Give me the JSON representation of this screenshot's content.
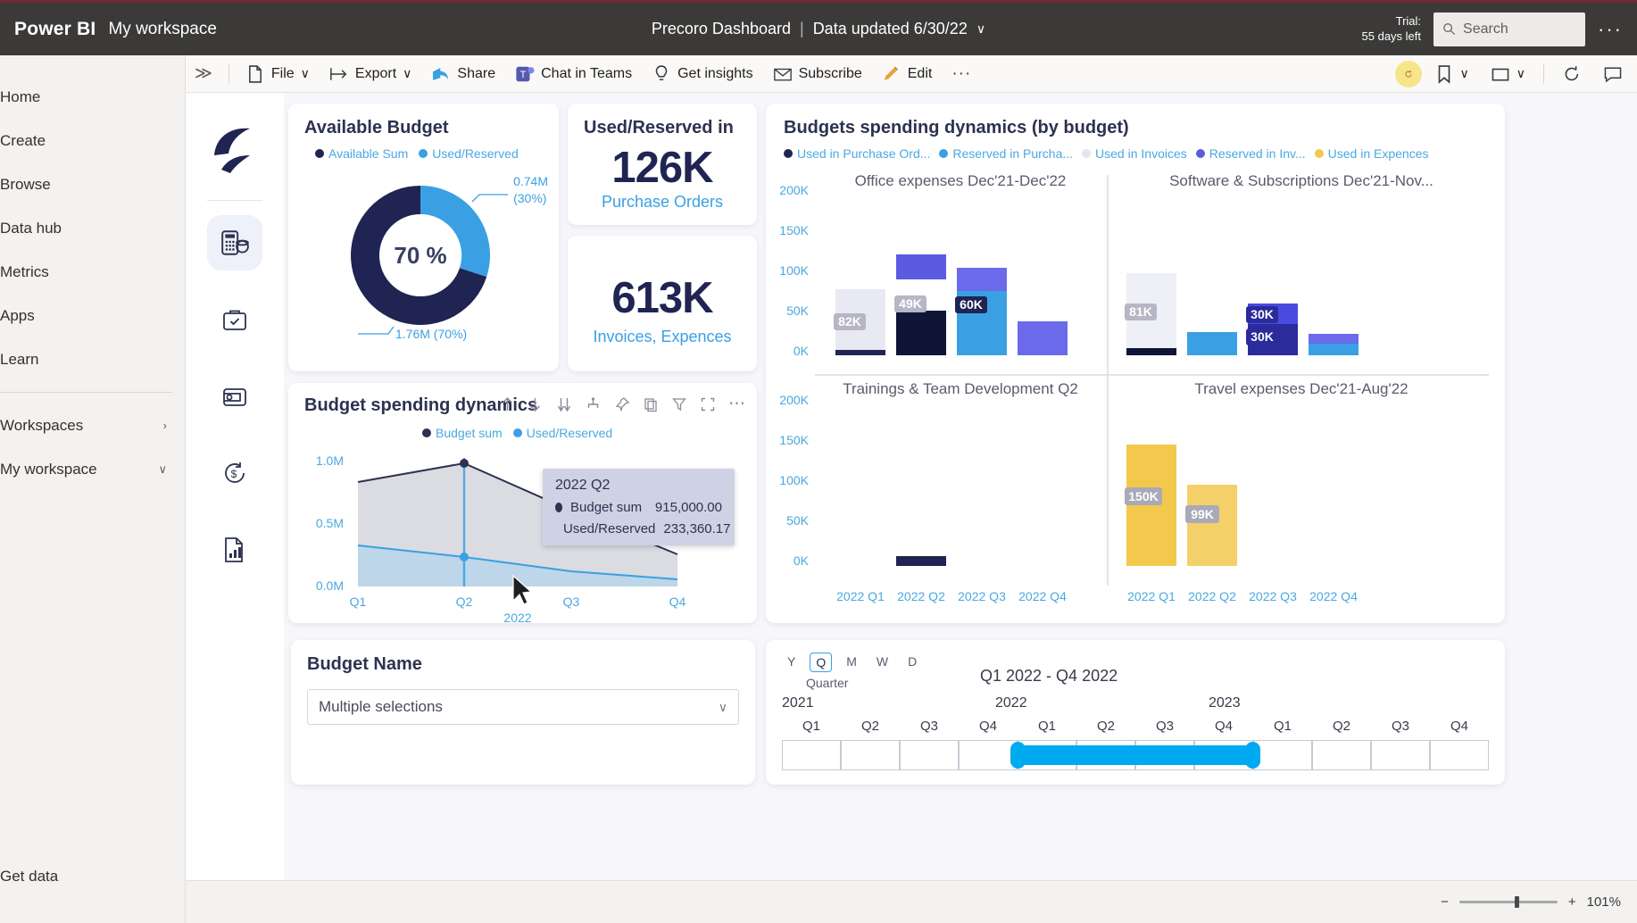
{
  "topbar": {
    "brand": "Power BI",
    "workspace": "My workspace",
    "report_title": "Precoro Dashboard",
    "separator": "|",
    "data_updated": "Data updated 6/30/22",
    "chevron": "∨",
    "trial_line1": "Trial:",
    "trial_line2": "55 days left",
    "search_placeholder": "Search",
    "more": "···"
  },
  "leftnav": {
    "items": [
      {
        "label": "Home"
      },
      {
        "label": "Create"
      },
      {
        "label": "Browse"
      },
      {
        "label": "Data hub"
      },
      {
        "label": "Metrics"
      },
      {
        "label": "Apps"
      },
      {
        "label": "Learn"
      }
    ],
    "groups": [
      {
        "label": "Workspaces",
        "arrow": "›"
      },
      {
        "label": "My workspace",
        "arrow": "∨"
      }
    ],
    "get_data": "Get data"
  },
  "ribbon": {
    "expand": "≫",
    "items": [
      {
        "label": "File",
        "icon": "file-icon",
        "chevron": "∨"
      },
      {
        "label": "Export",
        "icon": "export-icon",
        "chevron": "∨"
      },
      {
        "label": "Share",
        "icon": "share-icon",
        "chevron": ""
      },
      {
        "label": "Chat in Teams",
        "icon": "teams-icon",
        "chevron": ""
      },
      {
        "label": "Get insights",
        "icon": "bulb-icon",
        "chevron": ""
      },
      {
        "label": "Subscribe",
        "icon": "mail-icon",
        "chevron": ""
      },
      {
        "label": "Edit",
        "icon": "pencil-icon",
        "chevron": ""
      }
    ],
    "more": "···",
    "right_icons": [
      "reset-icon",
      "bookmark-icon",
      "view-icon",
      "refresh-icon",
      "comment-icon"
    ]
  },
  "colors": {
    "navy": "#1f2452",
    "lightblue": "#3aa0e3",
    "accent_text": "#4aa8e0",
    "purple": "#5b5be0",
    "yellow": "#f2c94c",
    "pale": "#e9e9f4",
    "title": "#2d3250"
  },
  "available_budget": {
    "title": "Available Budget",
    "legend": [
      {
        "label": "Available Sum",
        "color": "#1f2452"
      },
      {
        "label": "Used/Reserved",
        "color": "#3aa0e3"
      }
    ],
    "center_label": "70 %",
    "label_top": "0.74M\n(30%)",
    "label_top_l1": "0.74M",
    "label_top_l2": "(30%)",
    "label_bottom": "1.76M (70%)"
  },
  "chart_data": [
    {
      "type": "pie",
      "title": "Available Budget",
      "labels": [
        "Available Sum",
        "Used/Reserved"
      ],
      "values": [
        1.76,
        0.74
      ],
      "value_labels": [
        "1.76M (70%)",
        "0.74M (30%)"
      ],
      "percentages": [
        70,
        30
      ],
      "center_text": "70 %",
      "colors": [
        "#1f2452",
        "#3aa0e3"
      ],
      "legend_position": "top"
    },
    {
      "type": "line",
      "title": "Budget spending dynamics",
      "xlabel": "2022",
      "categories": [
        "Q1",
        "Q2",
        "Q3",
        "Q4"
      ],
      "series": [
        {
          "name": "Budget sum",
          "values": [
            880000,
            915000,
            590000,
            300000
          ],
          "color": "#2d3250"
        },
        {
          "name": "Used/Reserved",
          "values": [
            330000,
            233360,
            160000,
            60000
          ],
          "color": "#3aa0e3"
        }
      ],
      "yticks": [
        "0.0M",
        "0.5M",
        "1.0M"
      ],
      "ylim": [
        0,
        1000000
      ],
      "grid": false,
      "legend_position": "top",
      "tooltip": {
        "header": "2022 Q2",
        "rows": [
          {
            "name": "Budget sum",
            "value": "915,000.00",
            "color": "#2d3250"
          },
          {
            "name": "Used/Reserved",
            "value": "233,360.17",
            "color": "#3aa0e3"
          }
        ]
      }
    },
    {
      "type": "bar",
      "title": "Budgets spending dynamics (by budget)",
      "legend": [
        {
          "label": "Used in Purchase Ord...",
          "color": "#1f2452"
        },
        {
          "label": "Reserved in Purcha...",
          "color": "#3aa0e3"
        },
        {
          "label": "Used in Invoices",
          "color": "#e4e4f2"
        },
        {
          "label": "Reserved in Inv...",
          "color": "#5b5be0"
        },
        {
          "label": "Used in Expences",
          "color": "#f2c94c"
        }
      ],
      "yticks": [
        "0K",
        "50K",
        "100K",
        "150K",
        "200K"
      ],
      "ylim": [
        0,
        200000
      ],
      "panels": [
        {
          "title": "Office expenses Dec'21-Dec'22",
          "categories": [
            "2022 Q1",
            "2022 Q2",
            "2022 Q3",
            "2022 Q4"
          ],
          "bars": [
            {
              "label": "82K",
              "value": 82000,
              "color": "#e9e9f4"
            },
            {
              "label": "49K",
              "value": 49000,
              "color": "#5b5be0"
            },
            {
              "label": "60K",
              "value": 60000,
              "color": "#3aa0e3"
            },
            {
              "label": "",
              "value": 25000,
              "color": "#5b5be0"
            }
          ]
        },
        {
          "title": "Software & Subscriptions Dec'21-Nov...",
          "categories": [
            "2022 Q1",
            "2022 Q2",
            "2022 Q3",
            "2022 Q4"
          ],
          "bars": [
            {
              "label": "81K",
              "value": 81000,
              "color": "#e9e9f4"
            },
            {
              "label": "",
              "value": 22000,
              "color": "#3aa0e3"
            },
            {
              "label": "30K",
              "value": 30000,
              "color": "#5b5be0"
            },
            {
              "label": "",
              "value": 20000,
              "color": "#3aa0e3"
            }
          ]
        },
        {
          "title": "Trainings & Team Development Q2",
          "categories": [
            "2022 Q1",
            "2022 Q2",
            "2022 Q3",
            "2022 Q4"
          ],
          "bars": [
            {
              "label": "",
              "value": 0,
              "color": "#1f2452"
            },
            {
              "label": "",
              "value": 9000,
              "color": "#1f2452"
            },
            {
              "label": "",
              "value": 0,
              "color": "#1f2452"
            },
            {
              "label": "",
              "value": 0,
              "color": "#1f2452"
            }
          ]
        },
        {
          "title": "Travel expenses Dec'21-Aug'22",
          "categories": [
            "2022 Q1",
            "2022 Q2",
            "2022 Q3",
            "2022 Q4"
          ],
          "bars": [
            {
              "label": "150K",
              "value": 150000,
              "color": "#f2c94c"
            },
            {
              "label": "99K",
              "value": 99000,
              "color": "#f2c94c"
            },
            {
              "label": "",
              "value": 0,
              "color": "#f2c94c"
            },
            {
              "label": "",
              "value": 0,
              "color": "#f2c94c"
            }
          ]
        }
      ]
    }
  ],
  "kpi_cards": [
    {
      "title": "Used/Reserved in",
      "value": "126K",
      "subtitle": "Purchase Orders"
    },
    {
      "title": "",
      "value": "613K",
      "subtitle": "Invoices, Expences"
    }
  ],
  "line_card": {
    "title": "Budget spending dynamics",
    "legend": [
      {
        "label": "Budget sum",
        "color": "#2d3250"
      },
      {
        "label": "Used/Reserved",
        "color": "#3aa0e3"
      }
    ],
    "toolbar_icons": [
      "drill-up-icon",
      "drill-down-icon",
      "expand-hierarchy-icon",
      "drill-mode-icon",
      "pin-icon",
      "copy-icon",
      "filter-icon",
      "focus-icon",
      "more-options-icon"
    ],
    "yticks": [
      "1.0M",
      "0.5M",
      "0.0M"
    ],
    "xticks": [
      "Q1",
      "Q2",
      "Q3",
      "Q4"
    ],
    "xaxis_label": "2022",
    "tooltip_header": "2022 Q2",
    "tooltip_rows": [
      {
        "name": "Budget sum",
        "value": "915,000.00"
      },
      {
        "name": "Used/Reserved",
        "value": "233,360.17"
      }
    ]
  },
  "budget_name_slicer": {
    "title": "Budget Name",
    "selected": "Multiple selections",
    "chevron": "∨"
  },
  "timeline": {
    "units": [
      "Y",
      "Q",
      "M",
      "W",
      "D"
    ],
    "selected_unit": "Q",
    "unit_caption": "Quarter",
    "range_label": "Q1 2022 - Q4 2022",
    "years": [
      {
        "year": "2021",
        "quarters": [
          "Q1",
          "Q2",
          "Q3",
          "Q4"
        ]
      },
      {
        "year": "2022",
        "quarters": [
          "Q1",
          "Q2",
          "Q3",
          "Q4"
        ]
      },
      {
        "year": "2023",
        "quarters": [
          "Q1",
          "Q2",
          "Q3",
          "Q4"
        ]
      }
    ],
    "selected_from_index": 4,
    "selected_to_index": 7
  },
  "status": {
    "zoom_out": "−",
    "zoom_in": "+",
    "zoom_level": "101%"
  }
}
